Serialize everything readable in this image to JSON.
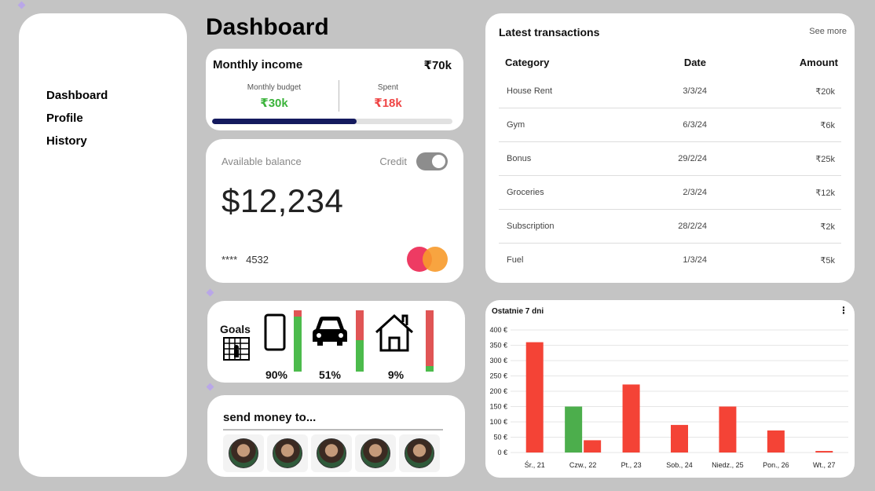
{
  "sidebar": {
    "items": [
      {
        "label": "Dashboard"
      },
      {
        "label": "Profile"
      },
      {
        "label": "History"
      }
    ]
  },
  "page_title": "Dashboard",
  "income": {
    "title": "Monthly income",
    "total": "₹70k",
    "budget_label": "Monthly budget",
    "budget_value": "₹30k",
    "spent_label": "Spent",
    "spent_value": "₹18k",
    "progress": 0.6,
    "colors": {
      "budget": "#3bb33b",
      "spent": "#ef4444",
      "progress": "#141a5e"
    }
  },
  "balance": {
    "label": "Available balance",
    "credit_label": "Credit",
    "credit_on": true,
    "amount": "$12,234",
    "card_mask": "****",
    "card_last4": "4532"
  },
  "goals": {
    "title": "Goals",
    "items": [
      {
        "icon": "phone-icon",
        "percent_label": "90%",
        "progress": 0.9
      },
      {
        "icon": "car-icon",
        "percent_label": "51%",
        "progress": 0.51
      },
      {
        "icon": "house-icon",
        "percent_label": "9%",
        "progress": 0.09
      }
    ],
    "colors": {
      "done": "#4cbb4c",
      "remaining": "#e05555"
    }
  },
  "send_money": {
    "title": "send money to...",
    "contacts": 5
  },
  "transactions": {
    "title": "Latest transactions",
    "see_more": "See more",
    "headers": {
      "category": "Category",
      "date": "Date",
      "amount": "Amount"
    },
    "rows": [
      {
        "category": "House Rent",
        "date": "3/3/24",
        "amount": "₹20k"
      },
      {
        "category": "Gym",
        "date": "6/3/24",
        "amount": "₹6k"
      },
      {
        "category": "Bonus",
        "date": "29/2/24",
        "amount": "₹25k"
      },
      {
        "category": "Groceries",
        "date": "2/3/24",
        "amount": "₹12k"
      },
      {
        "category": "Subscription",
        "date": "28/2/24",
        "amount": "₹2k"
      },
      {
        "category": "Fuel",
        "date": "1/3/24",
        "amount": "₹5k"
      }
    ]
  },
  "chart_data": {
    "type": "bar",
    "title": "Ostatnie 7 dni",
    "categories": [
      "Śr., 21",
      "Czw., 22",
      "Pt., 23",
      "Sob., 24",
      "Niedz., 25",
      "Pon., 26",
      "Wt., 27"
    ],
    "series": [
      {
        "color": "#4cae4c",
        "values": [
          0,
          150,
          0,
          0,
          0,
          0,
          0
        ]
      },
      {
        "color": "#f44336",
        "values": [
          360,
          40,
          222,
          90,
          150,
          72,
          5
        ]
      }
    ],
    "ylim": [
      0,
      400
    ],
    "yticks": [
      "0 €",
      "50 €",
      "100 €",
      "150 €",
      "200 €",
      "250 €",
      "300 €",
      "350 €",
      "400 €"
    ],
    "grid": true
  }
}
